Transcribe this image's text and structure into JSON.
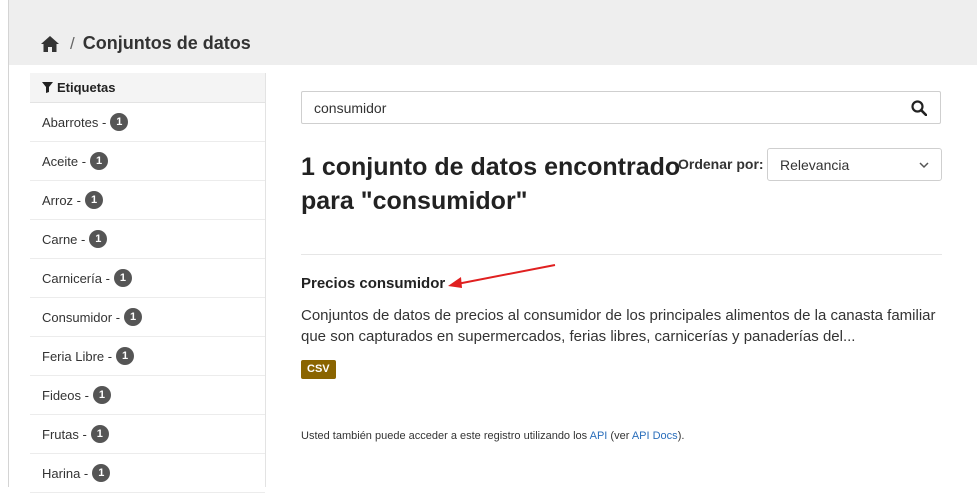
{
  "breadcrumb": {
    "home_icon": "home-icon",
    "separator": "/",
    "current": "Conjuntos de datos"
  },
  "sidebar": {
    "heading": "Etiquetas",
    "heading_icon": "filter-icon",
    "items": [
      {
        "label": "Abarrotes -",
        "count": "1"
      },
      {
        "label": "Aceite -",
        "count": "1"
      },
      {
        "label": "Arroz -",
        "count": "1"
      },
      {
        "label": "Carne -",
        "count": "1"
      },
      {
        "label": "Carnicería -",
        "count": "1"
      },
      {
        "label": "Consumidor -",
        "count": "1"
      },
      {
        "label": "Feria Libre -",
        "count": "1"
      },
      {
        "label": "Fideos -",
        "count": "1"
      },
      {
        "label": "Frutas -",
        "count": "1"
      },
      {
        "label": "Harina -",
        "count": "1"
      }
    ]
  },
  "search": {
    "value": "consumidor",
    "button_icon": "search-icon"
  },
  "results": {
    "title": "1 conjunto de datos encontrado para \"consumidor\"",
    "sort_label": "Ordenar por:",
    "sort_value": "Relevancia"
  },
  "dataset": {
    "title": "Precios consumidor",
    "description": "Conjuntos de datos de precios al consumidor de los principales alimentos de la canasta familiar que son capturados en supermercados, ferias libres, carnicerías y panaderías del...",
    "format": "CSV",
    "format_color": "#8a6400"
  },
  "api_note": {
    "prefix": "Usted también puede acceder a este registro utilizando los",
    "api_link": "API",
    "middle": "(ver",
    "docs_link": "API Docs",
    "suffix": ")."
  },
  "colors": {
    "annotation_arrow": "#e02020",
    "link": "#2a6ebb"
  }
}
